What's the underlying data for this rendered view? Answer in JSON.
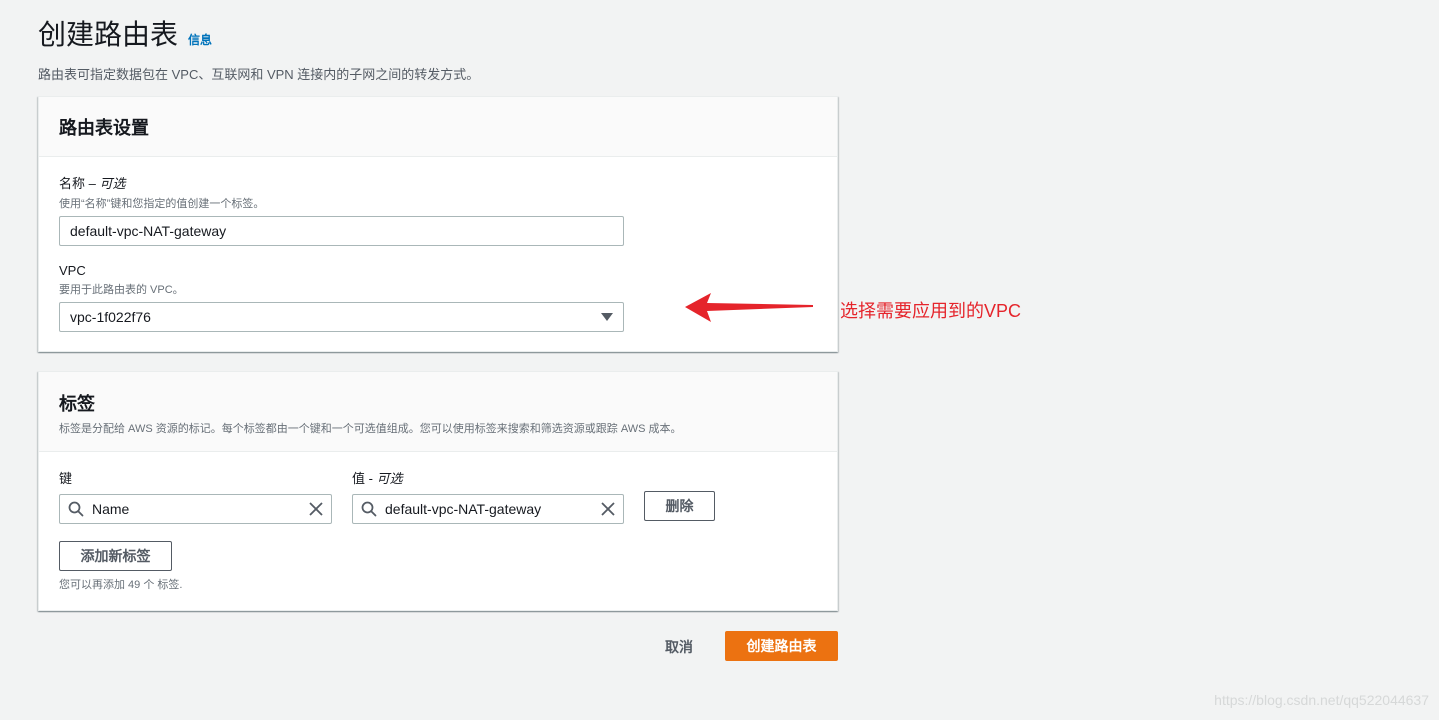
{
  "header": {
    "title": "创建路由表",
    "info_link": "信息",
    "description": "路由表可指定数据包在 VPC、互联网和 VPN 连接内的子网之间的转发方式。"
  },
  "settings_panel": {
    "title": "路由表设置",
    "name_field": {
      "label": "名称 – ",
      "optional": "可选",
      "description": "使用“名称”键和您指定的值创建一个标签。",
      "value": "default-vpc-NAT-gateway"
    },
    "vpc_field": {
      "label": "VPC",
      "description": "要用于此路由表的 VPC。",
      "selected": "vpc-1f022f76"
    }
  },
  "tags_panel": {
    "title": "标签",
    "description": "标签是分配给 AWS 资源的标记。每个标签都由一个键和一个可选值组成。您可以使用标签来搜索和筛选资源或跟踪 AWS 成本。",
    "key_label": "键",
    "value_label": "值 - ",
    "value_optional": "可选",
    "key_value": "Name",
    "value_value": "default-vpc-NAT-gateway",
    "remove_button": "删除",
    "add_button": "添加新标签",
    "hint": "您可以再添加 49 个 标签."
  },
  "footer": {
    "cancel": "取消",
    "submit": "创建路由表"
  },
  "annotation": {
    "text": "选择需要应用到的VPC",
    "color": "#e5242b"
  },
  "watermark": "https://blog.csdn.net/qq522044637",
  "colors": {
    "primary": "#ec7211",
    "link": "#0073bb",
    "background": "#f2f3f3"
  }
}
